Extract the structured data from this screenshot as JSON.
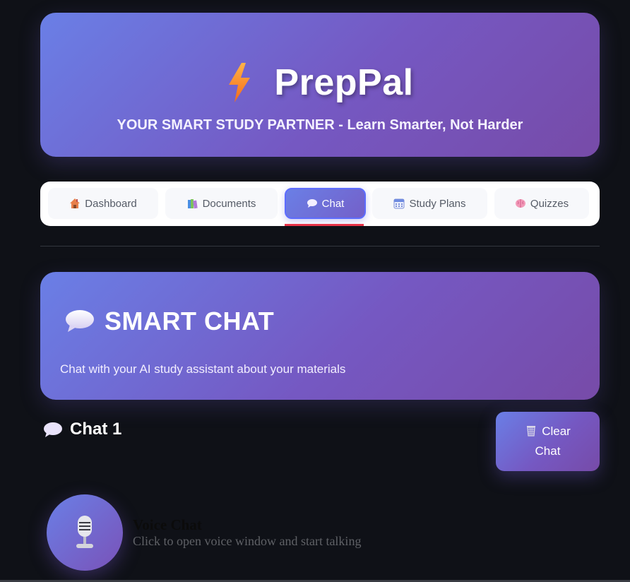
{
  "header": {
    "title": "PrepPal",
    "subtitle": "YOUR SMART STUDY PARTNER - Learn Smarter, Not Harder"
  },
  "tabs": [
    {
      "label": "Dashboard",
      "icon": "house-icon"
    },
    {
      "label": "Documents",
      "icon": "books-icon"
    },
    {
      "label": "Chat",
      "icon": "speech-bubble-icon",
      "active": true
    },
    {
      "label": "Study Plans",
      "icon": "calendar-icon"
    },
    {
      "label": "Quizzes",
      "icon": "brain-icon"
    }
  ],
  "chat_section": {
    "title": "SMART CHAT",
    "subtitle": "Chat with your AI study assistant about your materials"
  },
  "chat": {
    "name": "Chat 1",
    "clear_line1": "Clear",
    "clear_line2": "Chat"
  },
  "voice": {
    "title": "Voice Chat",
    "subtitle": "Click to open voice window and start talking"
  },
  "colors": {
    "background": "#0f1117",
    "gradient_start": "#6a7fe6",
    "gradient_end": "#774ba8",
    "tab_underline": "#e8344a"
  }
}
